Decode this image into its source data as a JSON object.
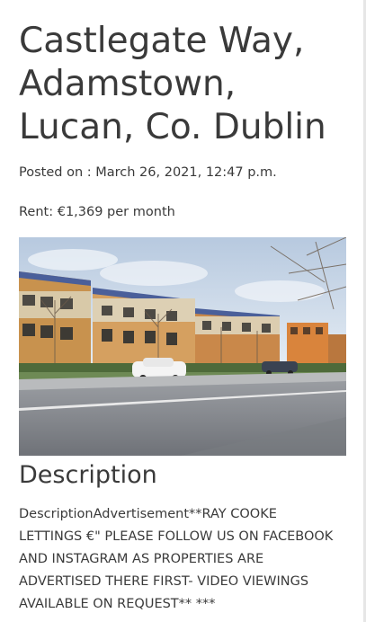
{
  "listing": {
    "title": "Castlegate Way, Adamstown, Lucan, Co. Dublin",
    "posted": "Posted on : March 26, 2021, 12:47 p.m.",
    "rent": "Rent: €1,369 per month"
  },
  "description": {
    "heading": "Description",
    "text": "DescriptionAdvertisement**RAY COOKE LETTINGS €\" PLEASE FOLLOW US ON FACEBOOK AND INSTAGRAM AS PROPERTIES ARE ADVERTISED THERE FIRST- VIDEO VIEWINGS AVAILABLE ON REQUEST** ***"
  },
  "colors": {
    "text": "#3a3a3a",
    "sky": "#c9d8ea",
    "road": "#8a8d92",
    "brick": "#c98a4a"
  }
}
